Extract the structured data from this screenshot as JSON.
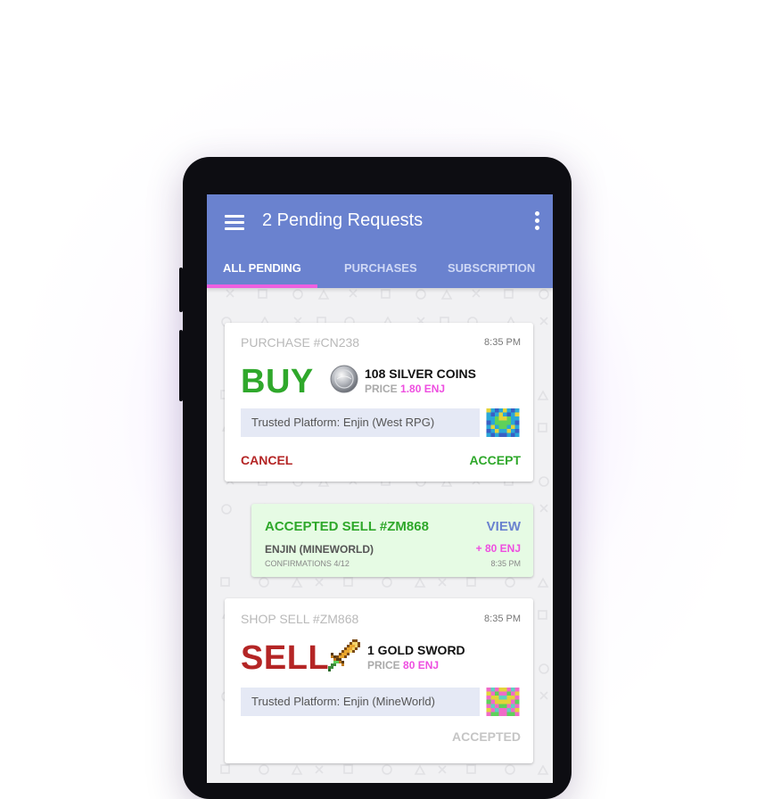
{
  "app": {
    "title": "2 Pending Requests",
    "icons": {
      "menu": "menu-icon",
      "more": "more-vert-icon"
    }
  },
  "tabs": [
    {
      "label": "ALL PENDING",
      "active": true
    },
    {
      "label": "PURCHASES",
      "active": false
    },
    {
      "label": "SUBSCRIPTION",
      "active": false
    }
  ],
  "colors": {
    "appbar": "#6a82cf",
    "tab_indicator": "#ee5fe0",
    "buy": "#2fa82b",
    "sell": "#b42525",
    "enj": "#ee4ee0",
    "view": "#6a82cf"
  },
  "purchase_card": {
    "header": "PURCHASE #CN238",
    "time": "8:35 PM",
    "action_word": "BUY",
    "item_icon": "silver-coin-icon",
    "item_name": "108 SILVER COINS",
    "price_label": "PRICE",
    "price_value": "1.80 ENJ",
    "platform": "Trusted Platform: Enjin (West RPG)",
    "cancel_label": "CANCEL",
    "accept_label": "ACCEPT"
  },
  "accepted_card": {
    "title": "ACCEPTED SELL #ZM868",
    "view_label": "VIEW",
    "platform": "ENJIN (MINEWORLD)",
    "amount": "+ 80 ENJ",
    "confirmations": "CONFIRMATIONS 4/12",
    "time": "8:35 PM"
  },
  "sell_card": {
    "header": "SHOP SELL #ZM868",
    "time": "8:35 PM",
    "action_word": "SELL",
    "item_icon": "gold-sword-icon",
    "item_name": "1 GOLD SWORD",
    "price_label": "PRICE",
    "price_value": "80 ENJ",
    "platform": "Trusted Platform: Enjin (MineWorld)",
    "status_label": "ACCEPTED"
  }
}
